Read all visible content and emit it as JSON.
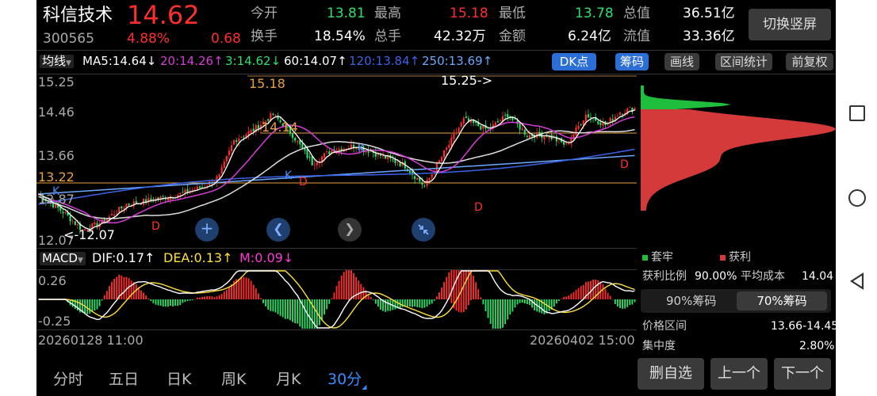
{
  "stock": {
    "name": "科信技术",
    "price": "14.62",
    "code": "300565",
    "change_pct": "4.88%",
    "change": "0.68"
  },
  "quote": {
    "open_label": "今开",
    "open": "13.81",
    "high_label": "最高",
    "high": "15.18",
    "low_label": "最低",
    "low": "13.78",
    "mcap_label": "总值",
    "mcap": "36.51亿",
    "turnover_label": "换手",
    "turnover": "18.54%",
    "volume_label": "总手",
    "volume": "42.32万",
    "amount_label": "金额",
    "amount": "6.24亿",
    "float_label": "流值",
    "float_mcap": "33.36亿"
  },
  "switch_button": "切换竖屏",
  "ma_bar": {
    "selector": "均线",
    "ma5": "MA5:14.64↓",
    "ma20": "20:14.26↑",
    "ma3": "3:14.62↓",
    "ma60": "60:14.07↑",
    "ma120": "120:13.84↑",
    "ma250": "250:13.69↑"
  },
  "tools": {
    "dk": "DK点",
    "chips": "筹码",
    "draw": "画线",
    "range": "区间统计",
    "adjust": "前复权"
  },
  "chart_labels": {
    "y1": "15.25",
    "y2": "14.46",
    "y3": "13.66",
    "y4": "12.87",
    "y5": "12.07",
    "high_mark": "15.18",
    "level_mark": "14.14",
    "support_mark": "13.22",
    "top_arrow": "15.25->",
    "low_arrow": "<-12.07"
  },
  "macd": {
    "selector": "MACD",
    "dif": "DIF:0.17↑",
    "dea": "DEA:0.13↑",
    "m": "M:0.09↓",
    "y_top": "0.26",
    "y_bottom": "-0.25"
  },
  "dates": {
    "start": "20260128 11:00",
    "end": "20260402 15:00"
  },
  "chip_panel": {
    "legend_trap": "套牢",
    "legend_profit": "获利",
    "profit_ratio_label": "获利比例",
    "profit_ratio": "90.00%",
    "avg_cost_label": "平均成本",
    "avg_cost": "14.04",
    "tab_90": "90%筹码",
    "tab_70": "70%筹码",
    "price_range_label": "价格区间",
    "price_range": "13.66-14.45",
    "concentration_label": "集中度",
    "concentration": "2.80%"
  },
  "bottom_tabs": [
    "分时",
    "五日",
    "日K",
    "周K",
    "月K",
    "30分"
  ],
  "bottom_buttons": {
    "remove": "删自选",
    "prev": "上一个",
    "next": "下一个"
  },
  "colors": {
    "up": "#ff2e2e",
    "down": "#2ee06a",
    "ma5": "#ffffff",
    "ma20": "#d63cd6",
    "ma60": "#ffffff",
    "ma120": "#3b63e8",
    "ma250": "#6aa8ff",
    "accent": "#3a8bff"
  }
}
